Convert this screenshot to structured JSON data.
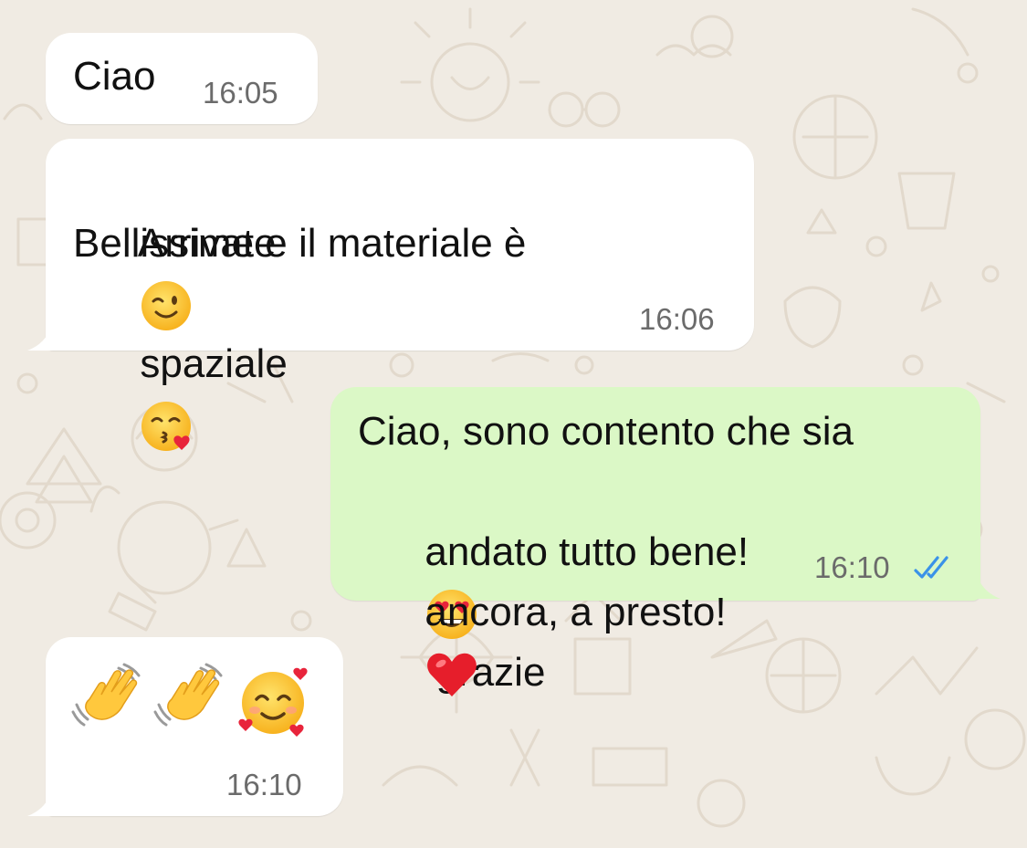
{
  "chat": {
    "messages": [
      {
        "direction": "incoming",
        "text": "Ciao",
        "time": "16:05"
      },
      {
        "direction": "incoming",
        "line1": "Arrivate",
        "line1_emoji": "winking-face-emoji",
        "line2": "Bellissime e il materiale è",
        "line3": "spaziale",
        "line3_emoji": "face-blowing-kiss-emoji",
        "time": "16:06"
      },
      {
        "direction": "outgoing",
        "line1": "Ciao, sono contento che sia",
        "line2a": "andato tutto bene!",
        "line2_emoji": "heart-eyes-emoji",
        "line2b": " grazie",
        "line3": "ancora, a presto! ",
        "line3_emoji": "red-heart-emoji",
        "time": "16:10",
        "status": "read"
      },
      {
        "direction": "incoming",
        "emojis": [
          "waving-hand-emoji",
          "waving-hand-emoji",
          "smiling-face-with-hearts-emoji"
        ],
        "time": "16:10"
      }
    ]
  },
  "colors": {
    "wallpaper": "#f0ebe3",
    "incoming_bubble": "#ffffff",
    "outgoing_bubble": "#dbf8c6",
    "read_ticks": "#3a92e8",
    "timestamp": "#6b6b6b"
  }
}
